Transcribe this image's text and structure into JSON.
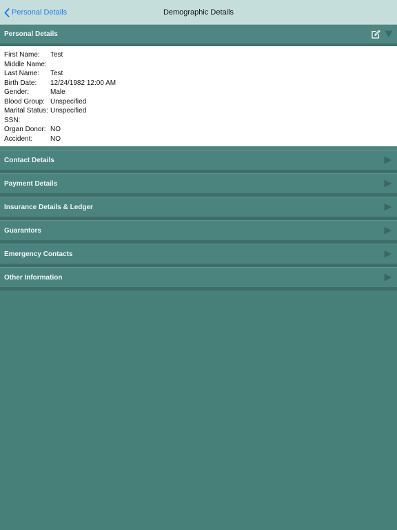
{
  "navbar": {
    "back_label": "Personal Details",
    "title": "Demographic Details"
  },
  "personal": {
    "header": "Personal Details",
    "fields": [
      {
        "label": "First Name:",
        "value": "Test"
      },
      {
        "label": "Middle Name:",
        "value": ""
      },
      {
        "label": "Last Name:",
        "value": "Test"
      },
      {
        "label": "Birth Date:",
        "value": "12/24/1982 12:00 AM"
      },
      {
        "label": "Gender:",
        "value": "Male"
      },
      {
        "label": "Blood Group:",
        "value": "Unspecified"
      },
      {
        "label": "Marital Status:",
        "value": "Unspecified"
      },
      {
        "label": "SSN:",
        "value": ""
      },
      {
        "label": "Organ Donor:",
        "value": "NO"
      },
      {
        "label": "Accident:",
        "value": "NO"
      }
    ]
  },
  "sections": [
    {
      "label": "Contact Details"
    },
    {
      "label": "Payment Details"
    },
    {
      "label": "Insurance Details & Ledger"
    },
    {
      "label": "Guarantors"
    },
    {
      "label": "Emergency Contacts"
    },
    {
      "label": "Other Information"
    }
  ],
  "icons": {
    "back": "chevron-left-icon",
    "edit": "edit-icon",
    "collapse": "triangle-down-icon",
    "expand": "triangle-right-icon"
  },
  "colors": {
    "navbar": "#c6dedb",
    "accent": "#1e7cf0",
    "section": "#4b847e",
    "background": "#477f79"
  }
}
